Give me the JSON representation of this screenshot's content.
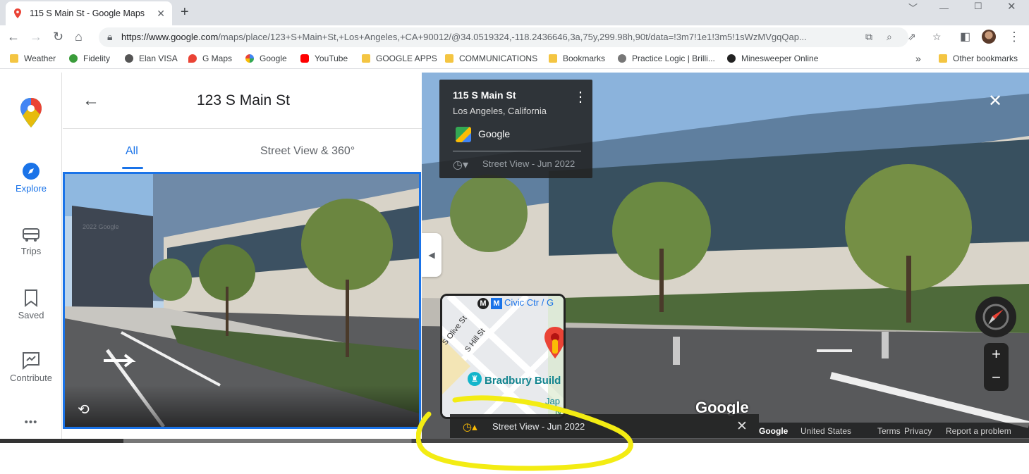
{
  "browser": {
    "tab_title": "115 S Main St - Google Maps",
    "url_host": "https://www.google.com",
    "url_path": "/maps/place/123+S+Main+St,+Los+Angeles,+CA+90012/@34.0519324,-118.2436646,3a,75y,299.98h,90t/data=!3m7!1e1!3m5!1sWzMVgqQap..."
  },
  "bookmarks": [
    {
      "label": "Weather",
      "icon": "folder-icon"
    },
    {
      "label": "Fidelity",
      "icon": "fidelity-icon"
    },
    {
      "label": "Elan VISA",
      "icon": "globe-icon"
    },
    {
      "label": "G Maps",
      "icon": "maps-pin-icon"
    },
    {
      "label": "Google",
      "icon": "google-g-icon"
    },
    {
      "label": "YouTube",
      "icon": "youtube-icon"
    },
    {
      "label": "GOOGLE APPS",
      "icon": "folder-icon"
    },
    {
      "label": "COMMUNICATIONS",
      "icon": "folder-icon"
    },
    {
      "label": "Bookmarks",
      "icon": "folder-icon"
    },
    {
      "label": "Practice Logic | Brilli...",
      "icon": "globe-icon"
    },
    {
      "label": "Minesweeper Online",
      "icon": "gear-icon"
    }
  ],
  "other_bookmarks": "Other bookmarks",
  "overflow_chevron": "»",
  "rail": {
    "explore": "Explore",
    "trips": "Trips",
    "saved": "Saved",
    "contribute": "Contribute",
    "more": "•••"
  },
  "panel": {
    "title": "123 S Main St",
    "tabs": [
      "All",
      "Street View & 360°"
    ]
  },
  "streetview": {
    "address": "115 S Main St",
    "city": "Los Angeles, California",
    "source": "Google",
    "date_label": "Street View - Jun 2022",
    "watermark": "Google",
    "photo_watermark": "2022 Google",
    "minimap": {
      "metro_label": "Civic Ctr / G",
      "street1": "S Olive St",
      "street2": "S Hill St",
      "poi": "Bradbury Build",
      "poi2": "Jap",
      "poi3": "N"
    },
    "bottom_date": "Street View - Jun 2022",
    "footer": [
      "Google",
      "United States",
      "Terms",
      "Privacy",
      "Report a problem"
    ]
  },
  "colors": {
    "accent": "#1a73e8",
    "highlight": "#f3ec13"
  }
}
